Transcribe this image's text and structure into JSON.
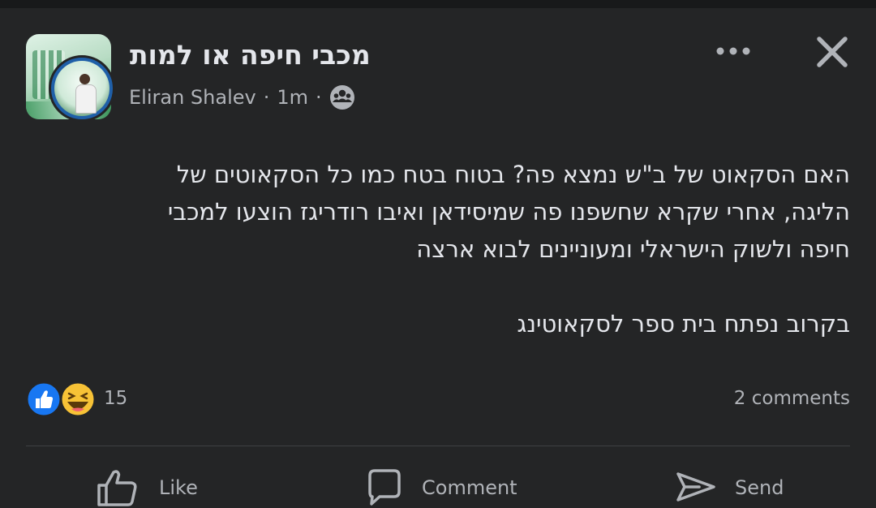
{
  "post": {
    "group_name": "מכבי חיפה או למות",
    "author": "Eliran Shalev",
    "time": "1m",
    "separator": "·",
    "audience_icon": "group-audience-icon",
    "more_icon": "more-dots-icon",
    "close_icon": "close-icon",
    "body_lines": [
      "האם הסקאוט של ב\"ש נמצא פה? בטוח בטח כמו כל הסקאוטים של",
      "הליגה, אחרי שקרא שחשפנו פה שמיסידאן ואיבו רודריגז הוצעו למכבי",
      "חיפה ולשוק הישראלי ומעוניינים לבוא ארצה"
    ],
    "body_line_last": "בקרוב נפתח בית ספר לסקאוטינג"
  },
  "reactions": {
    "icons": [
      "like-reaction-icon",
      "haha-reaction-icon"
    ],
    "count": "15",
    "comments": "2 comments"
  },
  "actions": {
    "like": "Like",
    "comment": "Comment",
    "send": "Send"
  },
  "colors": {
    "background": "#242526",
    "text": "#e4e6eb",
    "secondary_text": "#b0b3b8",
    "like_blue": "#1877f2",
    "haha_yellow": "#f7c236"
  }
}
